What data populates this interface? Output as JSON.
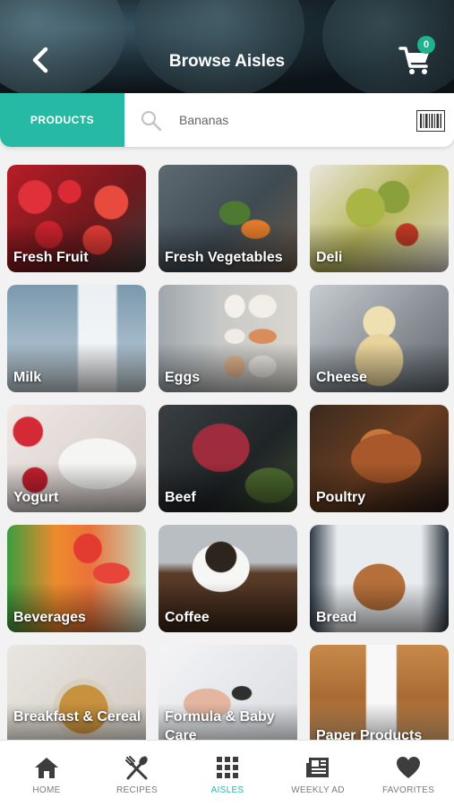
{
  "header": {
    "title": "Browse Aisles",
    "back_icon": "chevron-left-icon",
    "cart_icon": "cart-icon",
    "cart_count": "0"
  },
  "search": {
    "tab_label": "PRODUCTS",
    "placeholder": "Bananas",
    "value": "",
    "search_icon": "search-icon",
    "barcode_icon": "barcode-icon"
  },
  "aisles": [
    {
      "label": "Fresh Fruit"
    },
    {
      "label": "Fresh Vegetables"
    },
    {
      "label": "Deli"
    },
    {
      "label": "Milk"
    },
    {
      "label": "Eggs"
    },
    {
      "label": "Cheese"
    },
    {
      "label": "Yogurt"
    },
    {
      "label": "Beef"
    },
    {
      "label": "Poultry"
    },
    {
      "label": "Beverages"
    },
    {
      "label": "Coffee"
    },
    {
      "label": "Bread"
    },
    {
      "label": "Breakfast & Cereal"
    },
    {
      "label": "Formula & Baby Care"
    },
    {
      "label": "Paper Products"
    }
  ],
  "nav": {
    "home": "HOME",
    "recipes": "RECIPES",
    "aisles": "AISLES",
    "weekly_ad": "WEEKLY AD",
    "favorites": "FAVORITES",
    "active": "aisles"
  },
  "colors": {
    "accent": "#26b9a4",
    "badge": "#1db38b",
    "nav_inactive": "#7a7a7a"
  }
}
